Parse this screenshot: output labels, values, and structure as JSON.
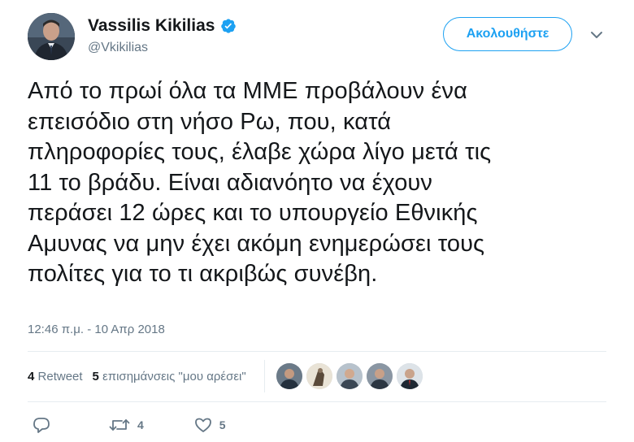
{
  "user": {
    "name": "Vassilis Kikilias",
    "handle": "@Vkikilias",
    "verified": true
  },
  "follow_button": {
    "label": "Ακολουθήστε"
  },
  "tweet": {
    "text": "Από το πρωί όλα τα ΜΜΕ προβάλουν ένα\nεπεισόδιο στη νήσο Ρω, που, κατά\nπληροφορίες τους, έλαβε χώρα λίγο μετά τις\n11 το βράδυ. Είναι αδιανόητο να έχουν\nπεράσει 12 ώρες και το υπουργείο Εθνικής\nΑμυνας να μην έχει ακόμη ενημερώσει τους\nπολίτες για το τι ακριβώς συνέβη.",
    "timestamp": "12:46 π.μ. - 10 Απρ 2018"
  },
  "stats": {
    "retweets_count": "4",
    "retweets_label": "Retweet",
    "likes_count": "5",
    "likes_label": "επισημάνσεις \"μου αρέσει\""
  },
  "actions": {
    "retweet_count": "4",
    "like_count": "5"
  },
  "colors": {
    "accent": "#1da1f2",
    "muted": "#657786",
    "text": "#14171a",
    "divider": "#e6ecf0"
  },
  "icons": [
    "verified-badge-icon",
    "chevron-down-icon",
    "reply-icon",
    "retweet-icon",
    "heart-icon"
  ]
}
